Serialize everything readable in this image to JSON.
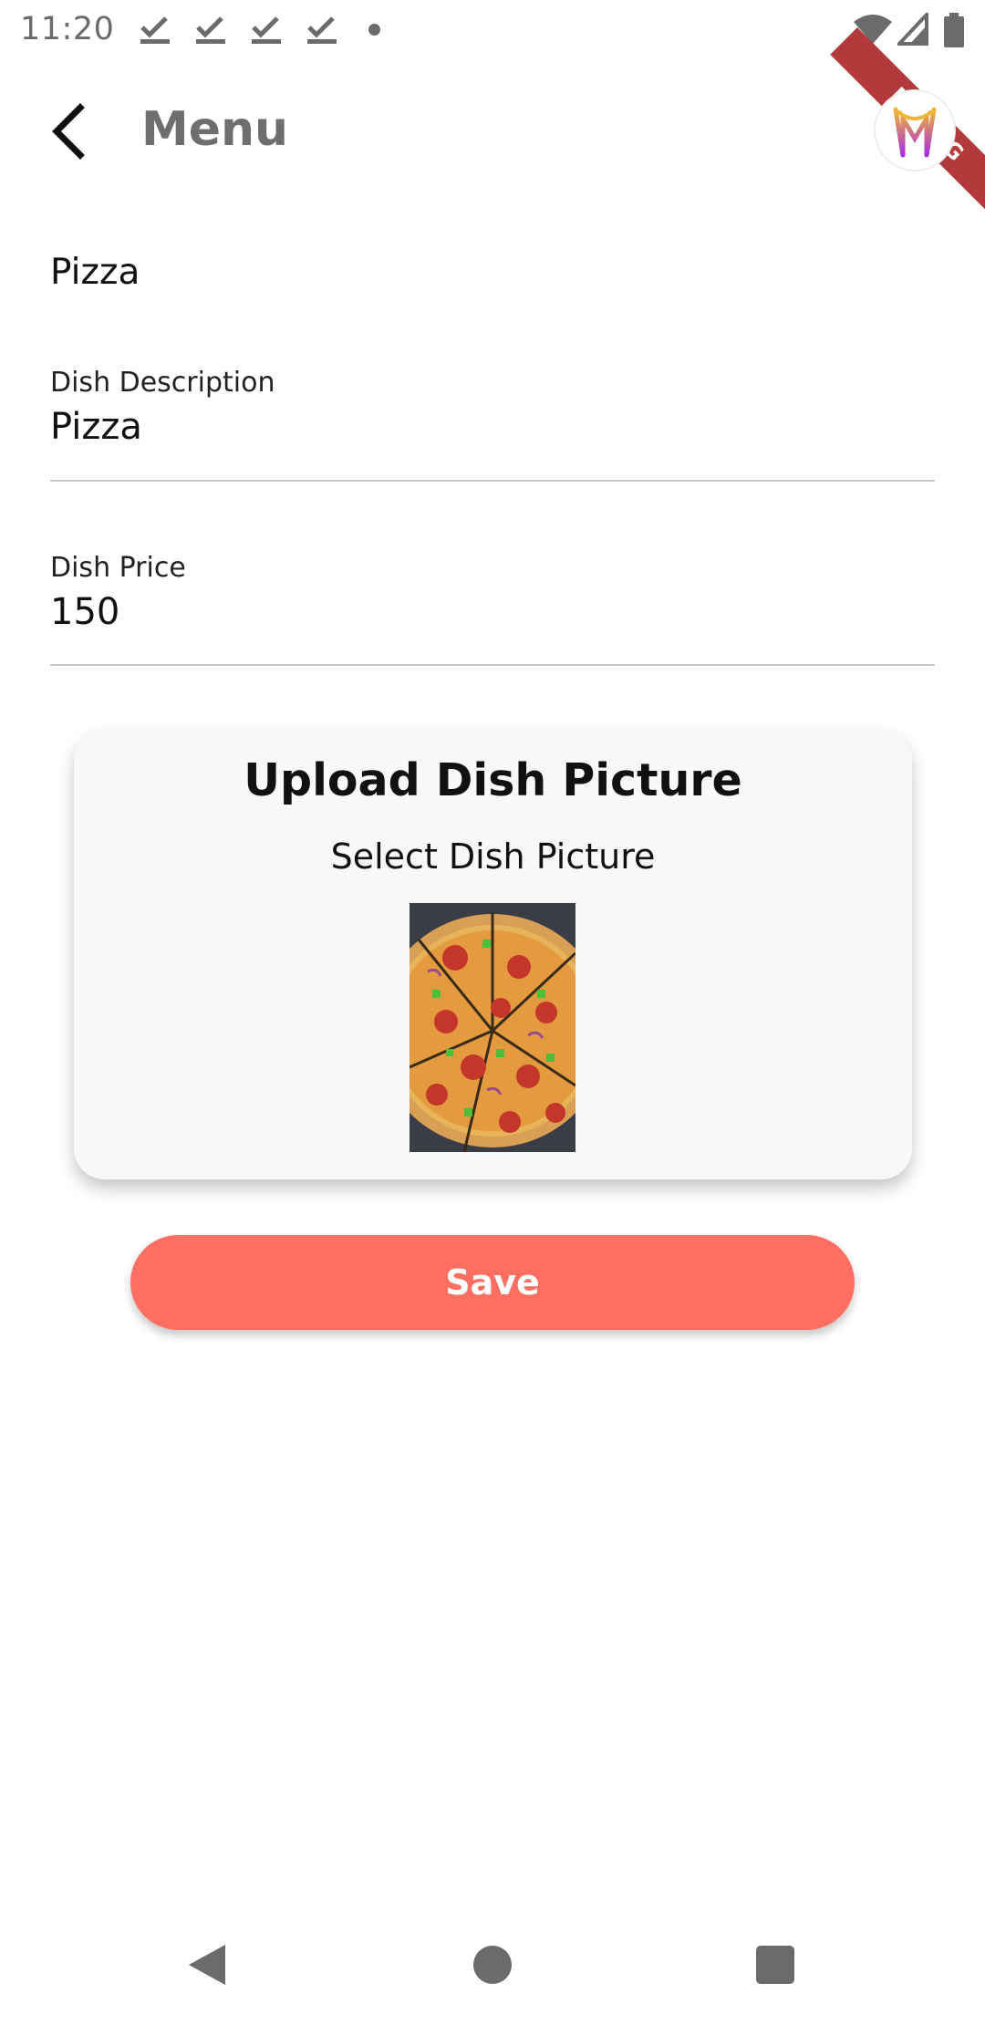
{
  "status_bar": {
    "time": "11:20",
    "notification_icons": [
      "download-done-icon",
      "download-done-icon",
      "download-done-icon",
      "download-done-icon"
    ],
    "system_icons": [
      "wifi-icon",
      "cellular-signal-icon",
      "battery-icon"
    ]
  },
  "debug_banner": "DEBUG",
  "app_bar": {
    "title": "Menu",
    "back_icon": "arrow-back-icon",
    "avatar_icon": "m-logo-icon"
  },
  "form": {
    "dish_name": "Pizza",
    "description": {
      "label": "Dish Description",
      "value": "Pizza"
    },
    "price": {
      "label": "Dish Price",
      "value": "150"
    }
  },
  "upload": {
    "title": "Upload Dish Picture",
    "subtitle": "Select Dish Picture"
  },
  "actions": {
    "save_label": "Save"
  },
  "colors": {
    "accent": "#ff6f61",
    "title_gray": "#6e6e6e",
    "card_bg": "#f8f8f8",
    "debug_ribbon": "#b23a3a"
  }
}
